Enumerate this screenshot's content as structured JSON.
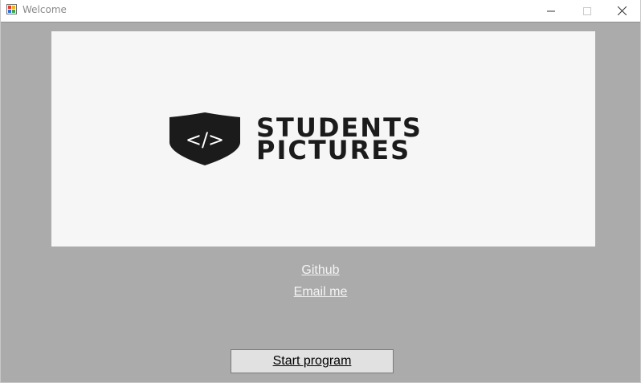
{
  "window": {
    "title": "Welcome",
    "controls": {
      "minimize": "minimize-icon",
      "maximize": "maximize-icon",
      "close": "close-icon"
    }
  },
  "banner": {
    "logo_line1": "STUDENTS",
    "logo_line2": "PICTURES",
    "logo_glyph": "</>"
  },
  "links": {
    "github": "Github",
    "email": "Email me"
  },
  "actions": {
    "start_label": "Start program"
  },
  "colors": {
    "window_bg": "#ababab",
    "banner_bg": "#f6f6f6",
    "logo": "#1b1b1b",
    "link": "#f4f4f4",
    "button_bg": "#e1e1e1"
  }
}
